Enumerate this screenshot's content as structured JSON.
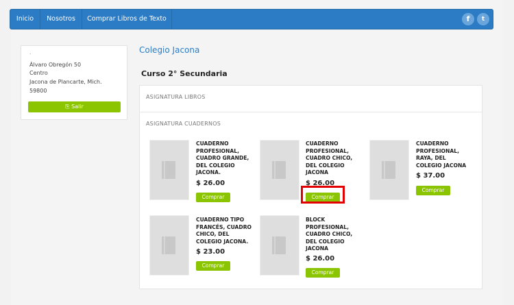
{
  "nav": {
    "items": [
      "Inicio",
      "Nosotros",
      "Comprar Libros de Texto"
    ],
    "social": [
      "f",
      "t"
    ]
  },
  "sidebar": {
    "dot": ".",
    "address": [
      "Álvaro Obregón 50",
      "Centro",
      "Jacona de Plancarte, Mich.",
      "59800"
    ],
    "logout_label": "Salir"
  },
  "school_title": "Colegio Jacona",
  "course_title": "Curso 2° Secundaria",
  "sections": {
    "books": "ASIGNATURA LIBROS",
    "notebooks": "ASIGNATURA CUADERNOS"
  },
  "products": [
    {
      "title": "CUADERNO PROFESIONAL, CUADRO GRANDE, DEL COLEGIO JACONA.",
      "price": "$ 26.00",
      "button": "Comprar"
    },
    {
      "title": "CUADERNO PROFESIONAL, CUADRO CHICO, DEL COLEGIO JACONA",
      "price": "$ 26.00",
      "button": "Comprar"
    },
    {
      "title": "CUADERNO PROFESIONAL, RAYA, DEL COLEGIO JACONA",
      "price": "$ 37.00",
      "button": "Comprar"
    },
    {
      "title": "CUADERNO TIPO FRANCÉS, CUADRO CHICO, DEL COLEGIO JACONA.",
      "price": "$ 23.00",
      "button": "Comprar"
    },
    {
      "title": "BLOCK PROFESIONAL, CUADRO CHICO, DEL COLEGIO JACONA",
      "price": "$ 26.00",
      "button": "Comprar"
    }
  ],
  "colors": {
    "nav": "#2b7cc5",
    "button": "#8bc400",
    "highlight": "#e30000"
  }
}
